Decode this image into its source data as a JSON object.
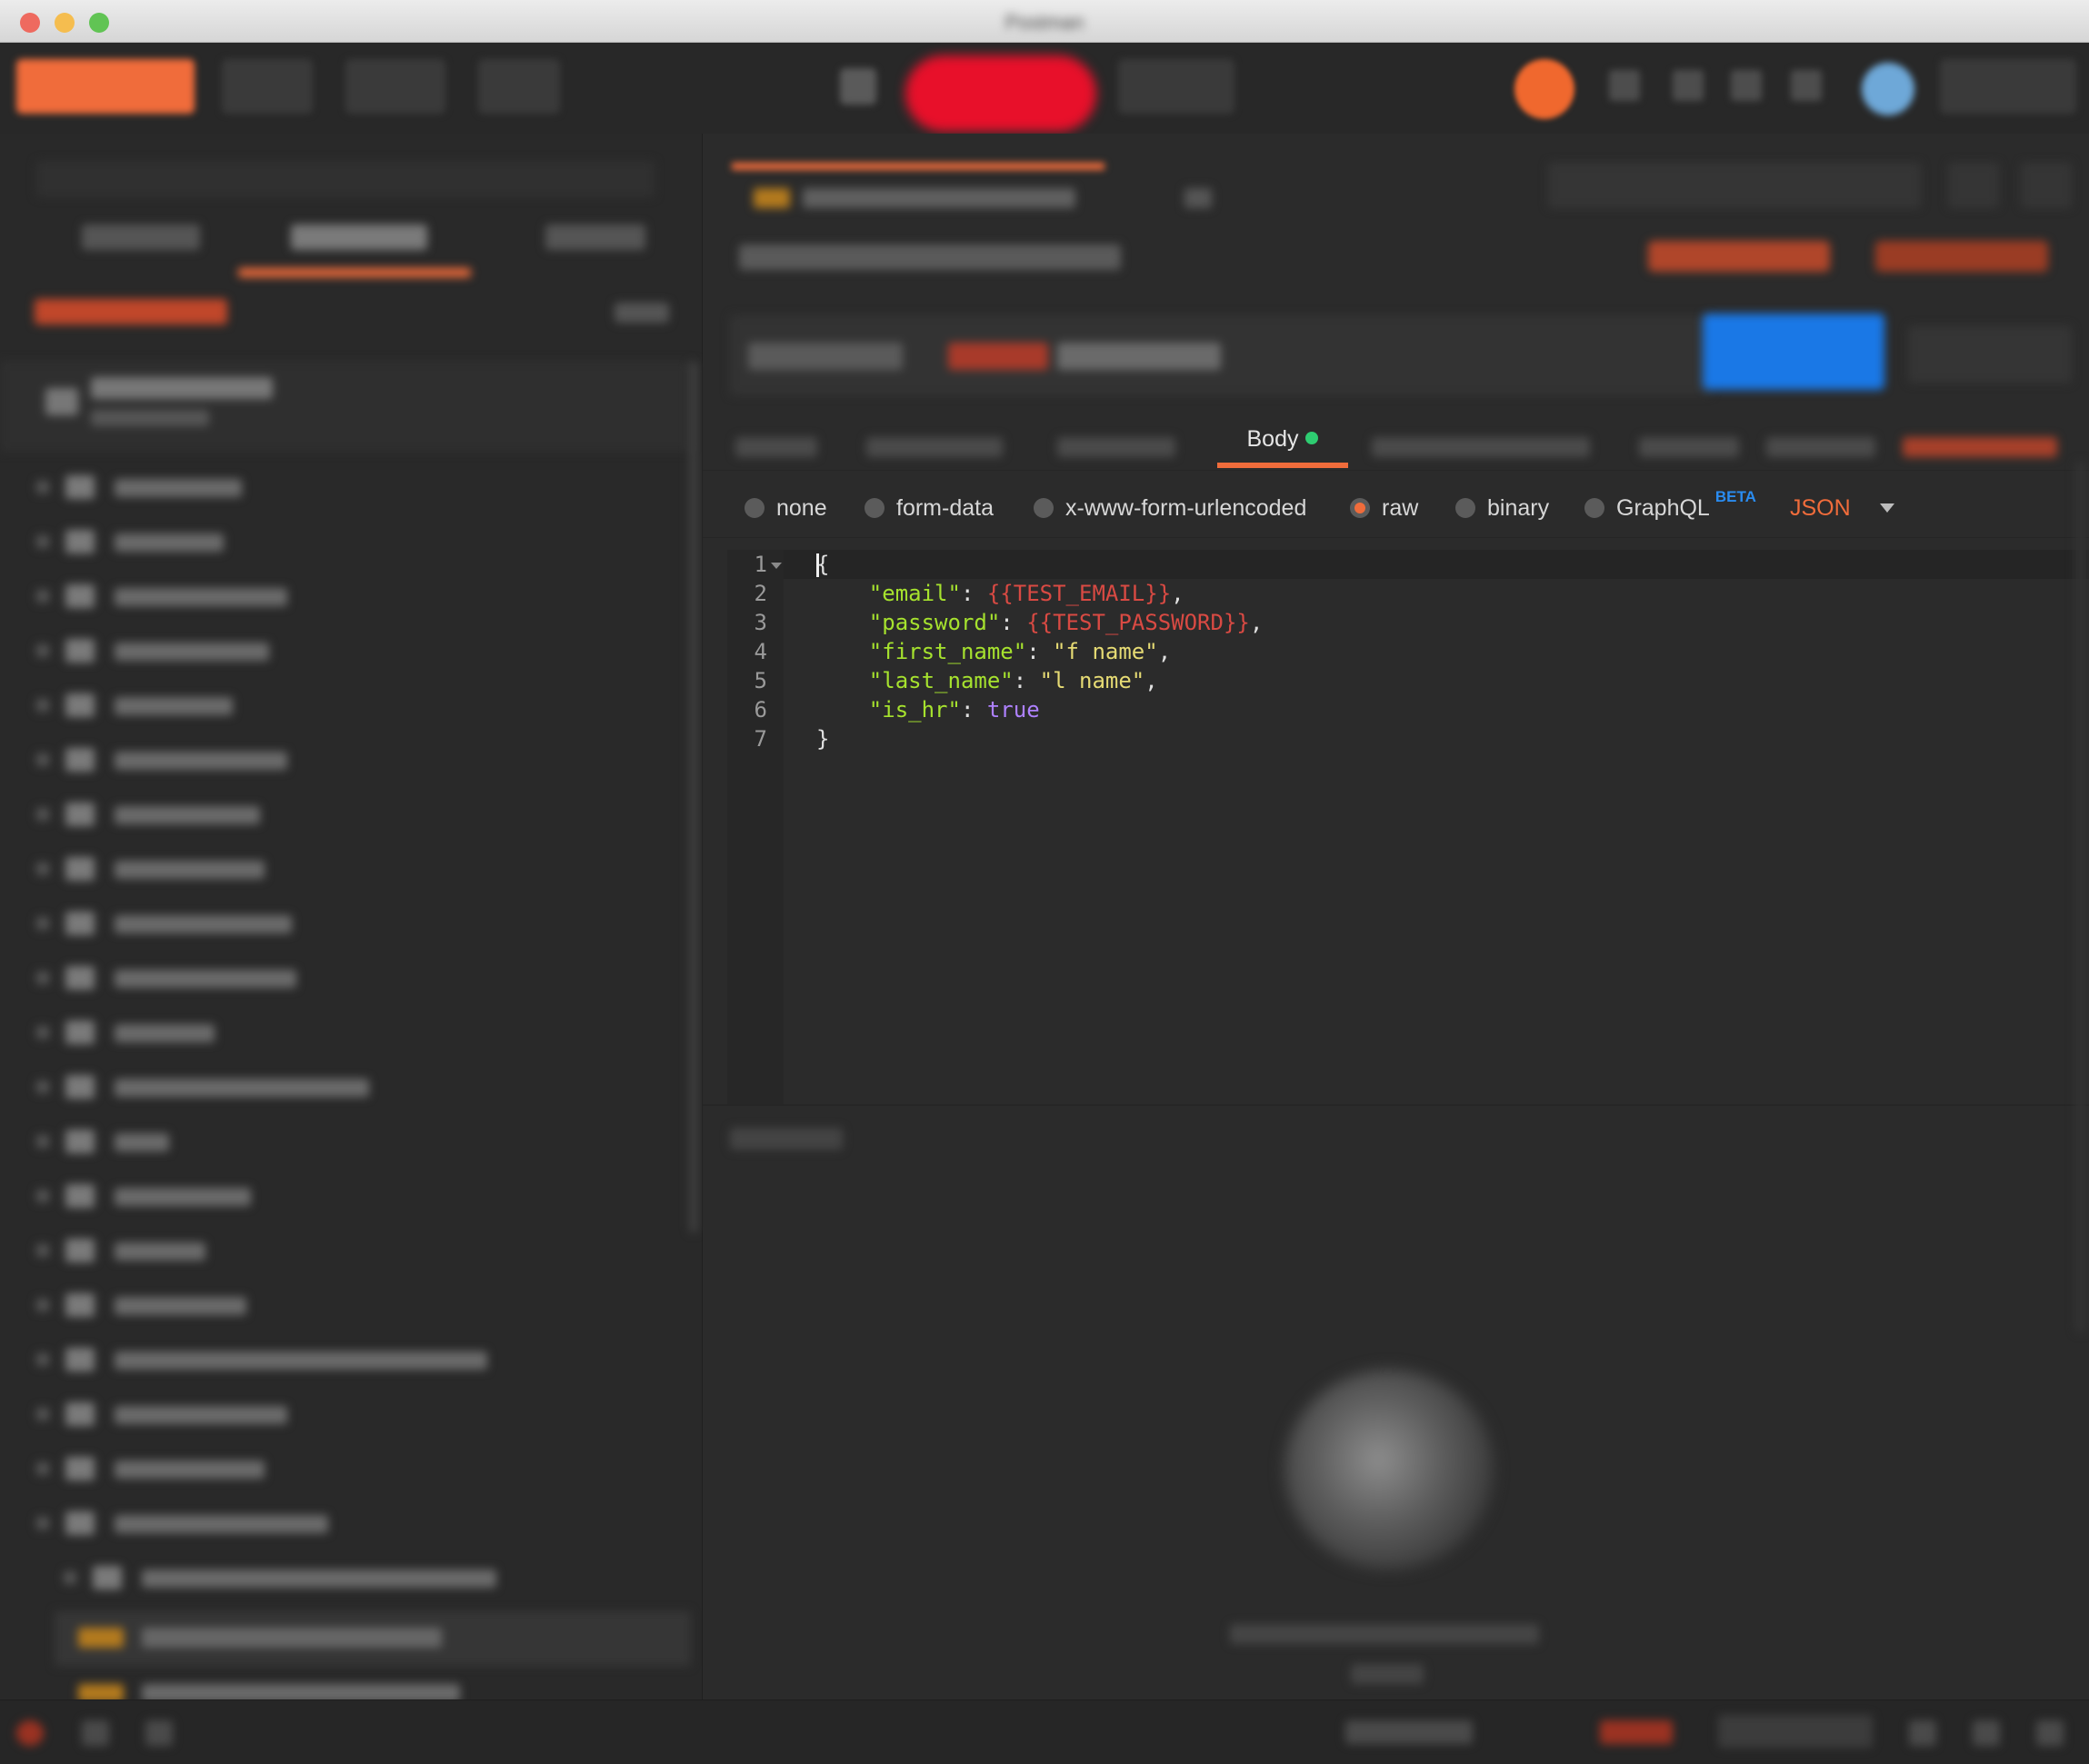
{
  "window": {
    "title": "Postman"
  },
  "request": {
    "body_tab": {
      "label": "Body"
    },
    "body_options": [
      {
        "label": "none",
        "selected": false
      },
      {
        "label": "form-data",
        "selected": false
      },
      {
        "label": "x-www-form-urlencoded",
        "selected": false
      },
      {
        "label": "raw",
        "selected": true
      },
      {
        "label": "binary",
        "selected": false
      },
      {
        "label": "GraphQL",
        "badge": "BETA",
        "selected": false
      }
    ],
    "language": "JSON",
    "editor": {
      "line_numbers": [
        "1",
        "2",
        "3",
        "4",
        "5",
        "6",
        "7"
      ],
      "lines": [
        {
          "parts": [
            {
              "t": "p",
              "text": "{"
            }
          ]
        },
        {
          "parts": [
            {
              "t": "p",
              "text": "    "
            },
            {
              "t": "k",
              "text": "\"email\""
            },
            {
              "t": "p",
              "text": ": "
            },
            {
              "t": "v",
              "text": "{{TEST_EMAIL}}"
            },
            {
              "t": "p",
              "text": ","
            }
          ]
        },
        {
          "parts": [
            {
              "t": "p",
              "text": "    "
            },
            {
              "t": "k",
              "text": "\"password\""
            },
            {
              "t": "p",
              "text": ": "
            },
            {
              "t": "v",
              "text": "{{TEST_PASSWORD}}"
            },
            {
              "t": "p",
              "text": ","
            }
          ]
        },
        {
          "parts": [
            {
              "t": "p",
              "text": "    "
            },
            {
              "t": "k",
              "text": "\"first_name\""
            },
            {
              "t": "p",
              "text": ": "
            },
            {
              "t": "s",
              "text": "\"f name\""
            },
            {
              "t": "p",
              "text": ","
            }
          ]
        },
        {
          "parts": [
            {
              "t": "p",
              "text": "    "
            },
            {
              "t": "k",
              "text": "\"last_name\""
            },
            {
              "t": "p",
              "text": ": "
            },
            {
              "t": "s",
              "text": "\"l name\""
            },
            {
              "t": "p",
              "text": ","
            }
          ]
        },
        {
          "parts": [
            {
              "t": "p",
              "text": "    "
            },
            {
              "t": "k",
              "text": "\"is_hr\""
            },
            {
              "t": "p",
              "text": ": "
            },
            {
              "t": "b",
              "text": "true"
            }
          ]
        },
        {
          "parts": [
            {
              "t": "p",
              "text": "}"
            }
          ]
        }
      ]
    }
  },
  "colors": {
    "accent": "#f06c3b",
    "send_button": "#1a78e6",
    "active_dot": "#2ecc71",
    "json_key": "#a6e22e",
    "json_variable": "#d94a43",
    "json_string": "#e6db74",
    "json_boolean": "#ae81ff"
  },
  "icons": {
    "fold": "chevron-down-icon",
    "language_dropdown": "caret-down-icon"
  }
}
